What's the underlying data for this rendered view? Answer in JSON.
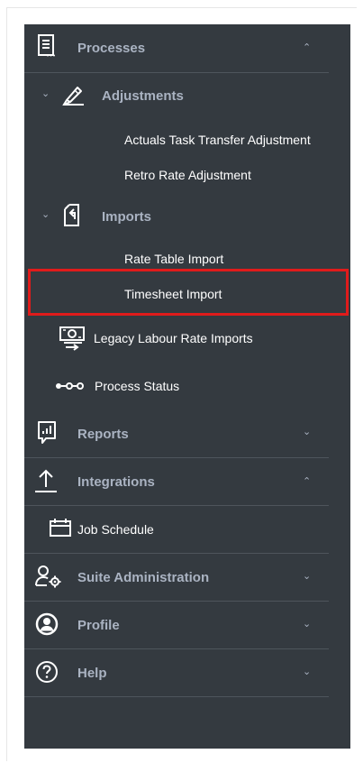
{
  "nav": {
    "processes": {
      "label": "Processes",
      "icon": "document-list-icon",
      "chevron": "up"
    },
    "adjustments": {
      "label": "Adjustments",
      "icon": "edit-pen-icon",
      "chevron": "down"
    },
    "actuals_task_transfer": {
      "label": "Actuals Task Transfer Adjustment"
    },
    "retro_rate": {
      "label": "Retro Rate Adjustment"
    },
    "imports": {
      "label": "Imports",
      "icon": "file-import-icon",
      "chevron": "down"
    },
    "rate_table_import": {
      "label": "Rate Table Import"
    },
    "timesheet_import": {
      "label": "Timesheet Import",
      "highlighted": true
    },
    "legacy_labour": {
      "label": "Legacy Labour Rate Imports",
      "icon": "money-transfer-icon"
    },
    "process_status": {
      "label": "Process Status",
      "icon": "steps-dots-icon"
    },
    "reports": {
      "label": "Reports",
      "icon": "bar-chart-icon",
      "chevron": "down"
    },
    "integrations": {
      "label": "Integrations",
      "icon": "upload-arrow-icon",
      "chevron": "up"
    },
    "job_schedule": {
      "label": "Job Schedule",
      "icon": "calendar-icon"
    },
    "suite_admin": {
      "label": "Suite Administration",
      "icon": "user-gear-icon",
      "chevron": "down"
    },
    "profile": {
      "label": "Profile",
      "icon": "user-circle-icon",
      "chevron": "down"
    },
    "help": {
      "label": "Help",
      "icon": "help-circle-icon",
      "chevron": "down"
    }
  },
  "colors": {
    "sidebar_bg": "#343a40",
    "section_text": "#aab3c2",
    "item_text": "#ffffff",
    "highlight": "#e01b1b"
  }
}
